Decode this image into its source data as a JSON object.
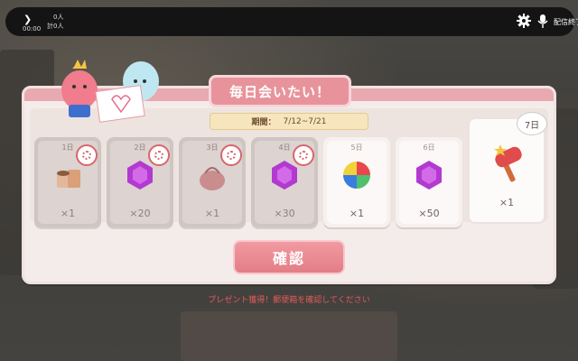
{
  "topbar": {
    "play_icon": "chevron-right-icon",
    "time": "00:00",
    "viewers_line1": "0人",
    "viewers_line2": "計0人",
    "gear_icon": "gear-icon",
    "mic_icon": "mic-icon",
    "end_label": "配信終了"
  },
  "modal": {
    "title": "毎日会いたい！",
    "period_label": "期間：",
    "period_value": "7/12~7/21",
    "days": [
      {
        "day": "1日",
        "qty": "×1",
        "claimed": true,
        "icon": "pudding-icon"
      },
      {
        "day": "2日",
        "qty": "×20",
        "claimed": true,
        "icon": "gem-icon"
      },
      {
        "day": "3日",
        "qty": "×1",
        "claimed": true,
        "icon": "bag-icon"
      },
      {
        "day": "4日",
        "qty": "×30",
        "claimed": true,
        "icon": "gem-icon"
      },
      {
        "day": "5日",
        "qty": "×1",
        "claimed": false,
        "icon": "ball-icon"
      },
      {
        "day": "6日",
        "qty": "×50",
        "claimed": false,
        "icon": "gem-icon"
      }
    ],
    "day7": {
      "day": "7日",
      "qty": "×1",
      "icon": "toy-hammer-icon"
    },
    "confirm_label": "確認",
    "notice": "プレゼント獲得！郵便箱を確認してください"
  },
  "colors": {
    "accent": "#e8939b",
    "notice": "#e25a5a",
    "gem": "#b23ad0"
  }
}
